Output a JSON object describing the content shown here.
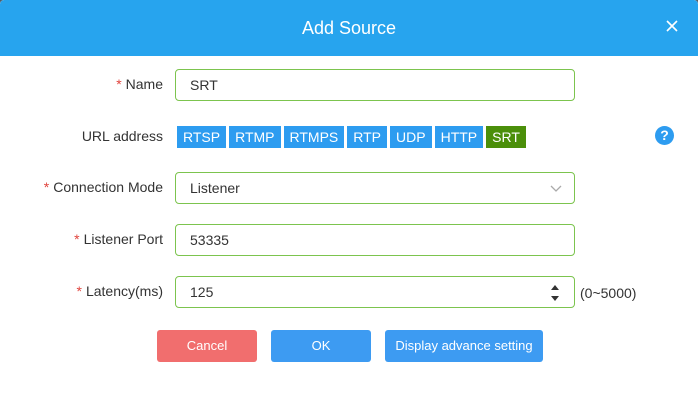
{
  "dialog": {
    "title": "Add Source"
  },
  "fields": {
    "name": {
      "label": "Name",
      "value": "SRT",
      "required": true
    },
    "url_address": {
      "label": "URL address",
      "protocols": [
        "RTSP",
        "RTMP",
        "RTMPS",
        "RTP",
        "UDP",
        "HTTP",
        "SRT"
      ],
      "selected": "SRT"
    },
    "connection_mode": {
      "label": "Connection Mode",
      "value": "Listener",
      "required": true
    },
    "listener_port": {
      "label": "Listener Port",
      "value": "53335",
      "required": true
    },
    "latency": {
      "label": "Latency(ms)",
      "value": "125",
      "range": "(0~5000)",
      "required": true
    }
  },
  "buttons": {
    "cancel": "Cancel",
    "ok": "OK",
    "advance": "Display advance setting"
  },
  "icons": {
    "close": "close-icon",
    "help": "help-icon",
    "chevron": "chevron-down-icon",
    "spinner": "number-spinner-icon"
  },
  "colors": {
    "header": "#27a4ee",
    "tab": "#2d9cf0",
    "tab_active": "#4b8f0a",
    "input_border": "#7cc44e",
    "cancel": "#f16e6e",
    "primary": "#3d9bf2",
    "required": "#e0443d"
  }
}
